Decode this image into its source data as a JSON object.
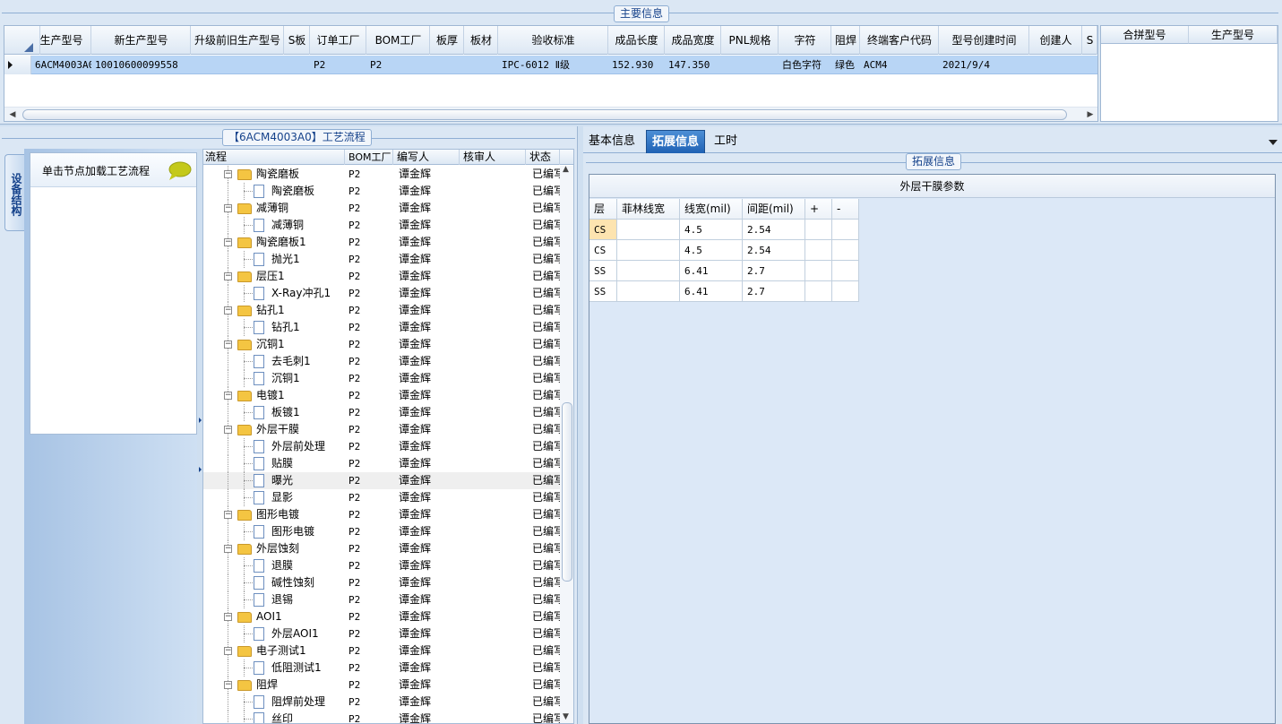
{
  "main_info": {
    "title": "主要信息",
    "columns": [
      "生产型号",
      "新生产型号",
      "升级前旧生产型号",
      "S板",
      "订单工厂",
      "BOM工厂",
      "板厚",
      "板材",
      "验收标准",
      "成品长度",
      "成品宽度",
      "PNL规格",
      "字符",
      "阻焊",
      "终端客户代码",
      "型号创建时间",
      "创建人",
      "S"
    ],
    "row": [
      "6ACM4003A0",
      "10010600099558",
      "",
      "",
      "P2",
      "P2",
      "",
      "",
      "IPC-6012 Ⅱ级",
      "152.930",
      "147.350",
      "",
      "白色字符",
      "绿色",
      "ACM4",
      "2021/9/4",
      "",
      ""
    ],
    "merge_columns": [
      "合拼型号",
      "生产型号"
    ]
  },
  "flow": {
    "title": "【6ACM4003A0】工艺流程",
    "side_tab": "设备结构",
    "tip": "单击节点加载工艺流程",
    "columns": [
      "流程",
      "BOM工厂",
      "编写人",
      "核审人",
      "状态"
    ],
    "rows": [
      {
        "name": "陶瓷磨板",
        "level": 0,
        "bom": "P2",
        "writer": "谭金辉",
        "reviewer": "",
        "status": "已编写"
      },
      {
        "name": "陶瓷磨板",
        "level": 1,
        "bom": "P2",
        "writer": "谭金辉",
        "reviewer": "",
        "status": "已编写"
      },
      {
        "name": "减薄铜",
        "level": 0,
        "bom": "P2",
        "writer": "谭金辉",
        "reviewer": "",
        "status": "已编写"
      },
      {
        "name": "减薄铜",
        "level": 1,
        "bom": "P2",
        "writer": "谭金辉",
        "reviewer": "",
        "status": "已编写"
      },
      {
        "name": "陶瓷磨板1",
        "level": 0,
        "bom": "P2",
        "writer": "谭金辉",
        "reviewer": "",
        "status": "已编写"
      },
      {
        "name": "抛光1",
        "level": 1,
        "bom": "P2",
        "writer": "谭金辉",
        "reviewer": "",
        "status": "已编写"
      },
      {
        "name": "层压1",
        "level": 0,
        "bom": "P2",
        "writer": "谭金辉",
        "reviewer": "",
        "status": "已编写"
      },
      {
        "name": "X-Ray冲孔1",
        "level": 1,
        "bom": "P2",
        "writer": "谭金辉",
        "reviewer": "",
        "status": "已编写"
      },
      {
        "name": "钻孔1",
        "level": 0,
        "bom": "P2",
        "writer": "谭金辉",
        "reviewer": "",
        "status": "已编写"
      },
      {
        "name": "钻孔1",
        "level": 1,
        "bom": "P2",
        "writer": "谭金辉",
        "reviewer": "",
        "status": "已编写"
      },
      {
        "name": "沉铜1",
        "level": 0,
        "bom": "P2",
        "writer": "谭金辉",
        "reviewer": "",
        "status": "已编写"
      },
      {
        "name": "去毛刺1",
        "level": 1,
        "bom": "P2",
        "writer": "谭金辉",
        "reviewer": "",
        "status": "已编写"
      },
      {
        "name": "沉铜1",
        "level": 1,
        "bom": "P2",
        "writer": "谭金辉",
        "reviewer": "",
        "status": "已编写"
      },
      {
        "name": "电镀1",
        "level": 0,
        "bom": "P2",
        "writer": "谭金辉",
        "reviewer": "",
        "status": "已编写"
      },
      {
        "name": "板镀1",
        "level": 1,
        "bom": "P2",
        "writer": "谭金辉",
        "reviewer": "",
        "status": "已编写"
      },
      {
        "name": "外层干膜",
        "level": 0,
        "bom": "P2",
        "writer": "谭金辉",
        "reviewer": "",
        "status": "已编写"
      },
      {
        "name": "外层前处理",
        "level": 1,
        "bom": "P2",
        "writer": "谭金辉",
        "reviewer": "",
        "status": "已编写"
      },
      {
        "name": "贴膜",
        "level": 1,
        "bom": "P2",
        "writer": "谭金辉",
        "reviewer": "",
        "status": "已编写"
      },
      {
        "name": "曝光",
        "level": 1,
        "bom": "P2",
        "writer": "谭金辉",
        "reviewer": "",
        "status": "已编写",
        "selected": true
      },
      {
        "name": "显影",
        "level": 1,
        "bom": "P2",
        "writer": "谭金辉",
        "reviewer": "",
        "status": "已编写"
      },
      {
        "name": "图形电镀",
        "level": 0,
        "bom": "P2",
        "writer": "谭金辉",
        "reviewer": "",
        "status": "已编写"
      },
      {
        "name": "图形电镀",
        "level": 1,
        "bom": "P2",
        "writer": "谭金辉",
        "reviewer": "",
        "status": "已编写"
      },
      {
        "name": "外层蚀刻",
        "level": 0,
        "bom": "P2",
        "writer": "谭金辉",
        "reviewer": "",
        "status": "已编写"
      },
      {
        "name": "退膜",
        "level": 1,
        "bom": "P2",
        "writer": "谭金辉",
        "reviewer": "",
        "status": "已编写"
      },
      {
        "name": "碱性蚀刻",
        "level": 1,
        "bom": "P2",
        "writer": "谭金辉",
        "reviewer": "",
        "status": "已编写"
      },
      {
        "name": "退锡",
        "level": 1,
        "bom": "P2",
        "writer": "谭金辉",
        "reviewer": "",
        "status": "已编写"
      },
      {
        "name": "AOI1",
        "level": 0,
        "bom": "P2",
        "writer": "谭金辉",
        "reviewer": "",
        "status": "已编写"
      },
      {
        "name": "外层AOI1",
        "level": 1,
        "bom": "P2",
        "writer": "谭金辉",
        "reviewer": "",
        "status": "已编写"
      },
      {
        "name": "电子测试1",
        "level": 0,
        "bom": "P2",
        "writer": "谭金辉",
        "reviewer": "",
        "status": "已编写"
      },
      {
        "name": "低阻测试1",
        "level": 1,
        "bom": "P2",
        "writer": "谭金辉",
        "reviewer": "",
        "status": "已编写"
      },
      {
        "name": "阻焊",
        "level": 0,
        "bom": "P2",
        "writer": "谭金辉",
        "reviewer": "",
        "status": "已编写"
      },
      {
        "name": "阻焊前处理",
        "level": 1,
        "bom": "P2",
        "writer": "谭金辉",
        "reviewer": "",
        "status": "已编写"
      },
      {
        "name": "丝印",
        "level": 1,
        "bom": "P2",
        "writer": "谭金辉",
        "reviewer": "",
        "status": "已编写"
      }
    ]
  },
  "detail": {
    "tabs": [
      "基本信息",
      "拓展信息",
      "工时"
    ],
    "active_tab": 1,
    "group_title": "拓展信息",
    "param_title": "外层干膜参数",
    "param_columns": [
      "层",
      "菲林线宽",
      "线宽(mil)",
      "间距(mil)",
      "+",
      "-"
    ],
    "param_rows": [
      [
        "CS",
        "",
        "4.5",
        "2.54",
        "",
        ""
      ],
      [
        "CS",
        "",
        "4.5",
        "2.54",
        "",
        ""
      ],
      [
        "SS",
        "",
        "6.41",
        "2.7",
        "",
        ""
      ],
      [
        "SS",
        "",
        "6.41",
        "2.7",
        "",
        ""
      ]
    ]
  },
  "colors": {
    "selection": "#b8d5f5",
    "highlight_cell": "#fde4b0",
    "active_tab": "#2a6fc4"
  }
}
